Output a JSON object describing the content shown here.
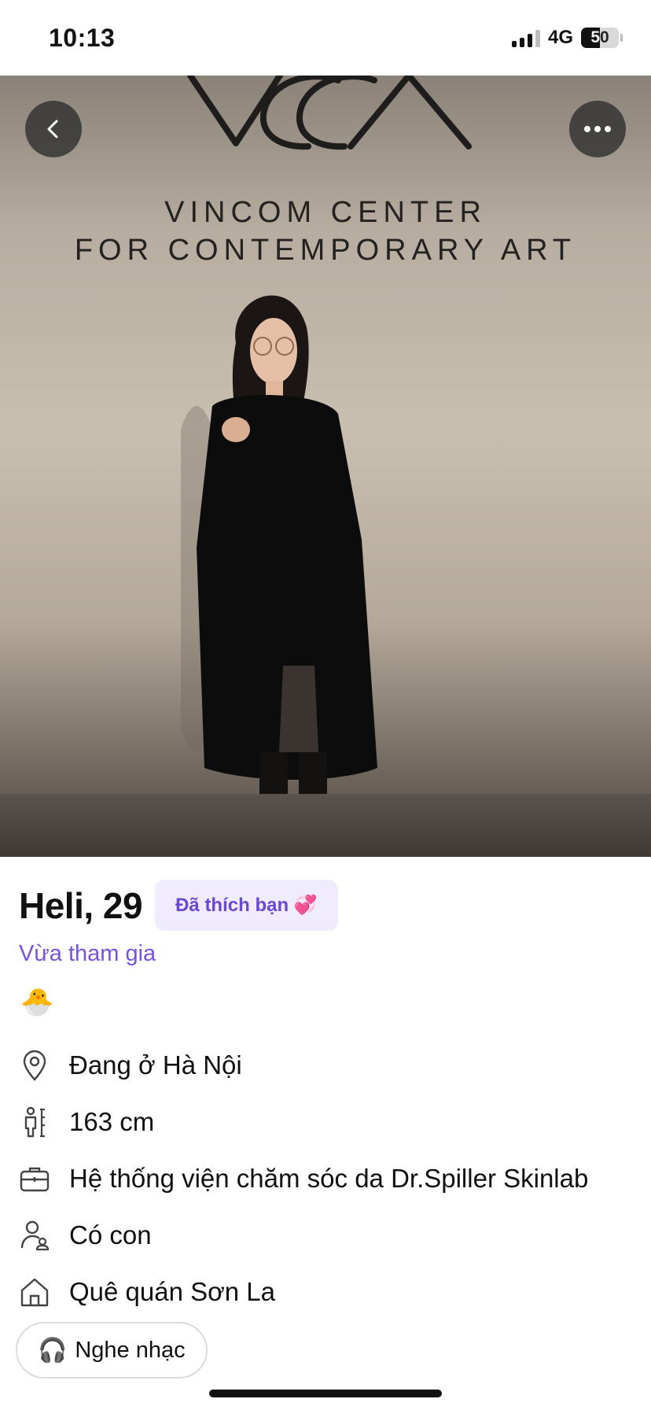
{
  "status_bar": {
    "time": "10:13",
    "network": "4G",
    "battery": "50",
    "battery_level": 0.5
  },
  "photo": {
    "logo_text": "VCCA",
    "sign_line1": "VINCOM CENTER",
    "sign_line2": "FOR CONTEMPORARY ART"
  },
  "profile": {
    "name_age": "Heli, 29",
    "liked_badge": "Đã thích bạn 💞",
    "joined": "Vừa tham gia",
    "chick_emoji": "🐣",
    "details": [
      {
        "icon": "location-pin-icon",
        "text": "Đang ở Hà Nội"
      },
      {
        "icon": "height-icon",
        "text": "163 cm"
      },
      {
        "icon": "briefcase-icon",
        "text": "Hệ thống viện chăm sóc da Dr.Spiller Skinlab"
      },
      {
        "icon": "family-icon",
        "text": "Có con"
      },
      {
        "icon": "home-icon",
        "text": "Quê quán Sơn La"
      }
    ]
  },
  "music": {
    "label": "Nghe nhạc",
    "emoji": "🎧"
  },
  "colors": {
    "accent": "#7a52dd",
    "badge_bg": "#f0ecfd"
  }
}
